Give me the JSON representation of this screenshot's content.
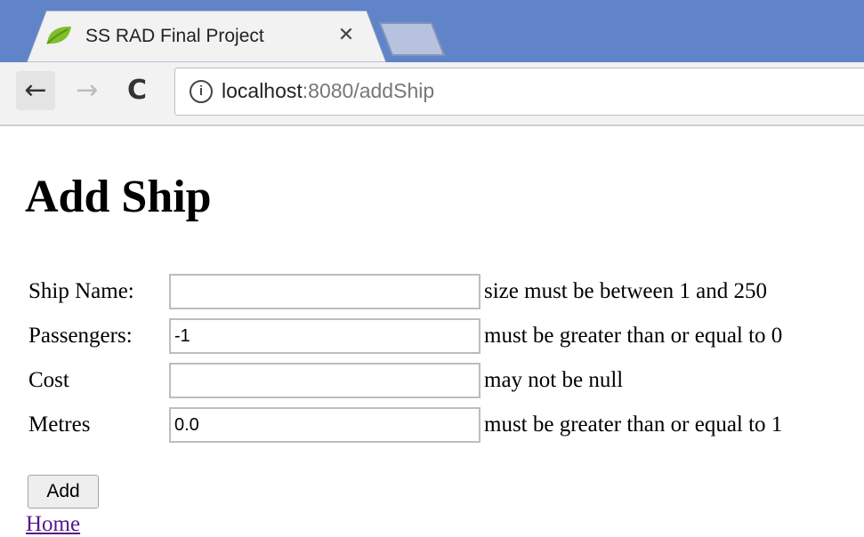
{
  "browser": {
    "tab_title": "SS RAD Final Project",
    "close_glyph": "✕",
    "url_host": "localhost",
    "url_rest": ":8080/addShip",
    "info_glyph": "i",
    "back_glyph": "←",
    "forward_glyph": "→",
    "reload_glyph": "C",
    "icons": {
      "favicon": "spring-leaf-icon",
      "info": "info-icon",
      "back": "arrow-left-icon",
      "forward": "arrow-right-icon",
      "reload": "reload-icon",
      "close": "close-icon"
    },
    "colors": {
      "tabstrip": "#6184c9",
      "toolbar": "#f2f2f2",
      "favicon": "#7fbf2a"
    }
  },
  "page": {
    "heading": "Add Ship",
    "fields": [
      {
        "label": "Ship Name:",
        "value": "",
        "error": "size must be between 1 and 250"
      },
      {
        "label": "Passengers:",
        "value": "-1",
        "error": "must be greater than or equal to 0"
      },
      {
        "label": "Cost",
        "value": "",
        "error": "may not be null"
      },
      {
        "label": "Metres",
        "value": "0.0",
        "error": "must be greater than or equal to 1"
      }
    ],
    "submit_label": "Add",
    "home_link": "Home",
    "colors": {
      "link": "#551a8b"
    }
  }
}
